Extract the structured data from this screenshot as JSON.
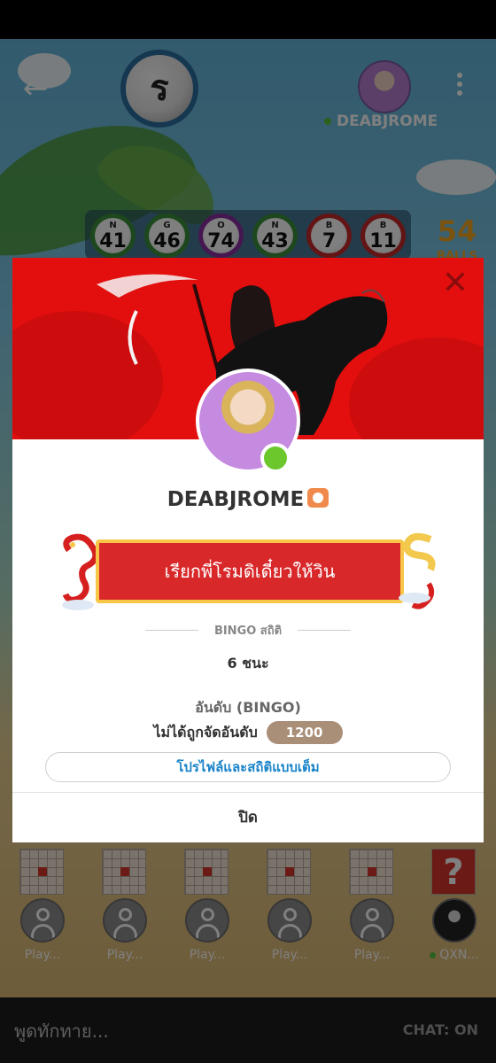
{
  "topbar": {
    "back_icon": "arrow-left-icon",
    "current_ball": "ร",
    "player_name": "DEABJROME",
    "menu_icon": "kebab-menu-icon"
  },
  "called_balls": [
    {
      "letter": "N",
      "number": "41",
      "color": "#3a8f3a"
    },
    {
      "letter": "G",
      "number": "46",
      "color": "#3a8f3a"
    },
    {
      "letter": "O",
      "number": "74",
      "color": "#8a2fa0"
    },
    {
      "letter": "N",
      "number": "43",
      "color": "#3a8f3a"
    },
    {
      "letter": "B",
      "number": "7",
      "color": "#c62828"
    },
    {
      "letter": "B",
      "number": "11",
      "color": "#c62828"
    }
  ],
  "balls_left": {
    "count": "54",
    "label": "BALLS"
  },
  "modal": {
    "close_icon": "close-icon",
    "name": "DEABJROME",
    "ribbon_text": "เรียกพี่โรมดิเดี๋ยวให้วิน",
    "section_title": "BINGO สถิติ",
    "wins": "6 ชนะ",
    "rank_title": "อันดับ (BINGO)",
    "rank_text": "ไม่ได้ถูกจัดอันดับ",
    "rank_points": "1200",
    "full_profile_button": "โปรไฟล์และสถิติแบบเต็ม",
    "close_button": "ปิด"
  },
  "players": [
    {
      "label": "Play..."
    },
    {
      "label": "Play..."
    },
    {
      "label": "Play..."
    },
    {
      "label": "Play..."
    },
    {
      "label": "Play..."
    },
    {
      "label": "QXN..."
    }
  ],
  "chat": {
    "placeholder": "พูดทักทาย...",
    "toggle": "CHAT: ON"
  },
  "colors": {
    "banner_red": "#e30e0e",
    "ribbon_red": "#d8282a",
    "link_blue": "#1a84c9",
    "online_green": "#6cc72d"
  }
}
